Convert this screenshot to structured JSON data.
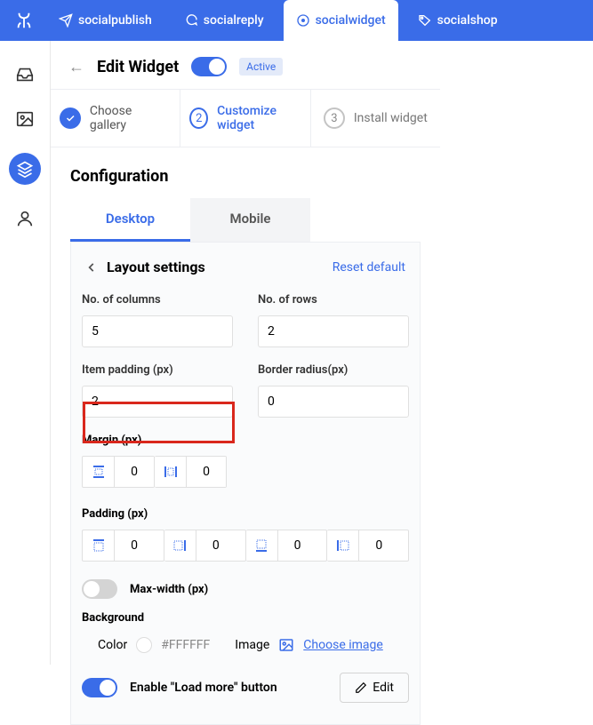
{
  "topnav": {
    "items": [
      {
        "label": "socialpublish"
      },
      {
        "label": "socialreply"
      },
      {
        "label": "socialwidget"
      },
      {
        "label": "socialshop"
      }
    ]
  },
  "page": {
    "title": "Edit Widget",
    "status_badge": "Active"
  },
  "steps": [
    {
      "num": "✓",
      "label": "Choose gallery"
    },
    {
      "num": "2",
      "label": "Customize widget"
    },
    {
      "num": "3",
      "label": "Install widget"
    }
  ],
  "configuration": {
    "title": "Configuration",
    "tabs": {
      "desktop": "Desktop",
      "mobile": "Mobile"
    }
  },
  "layout": {
    "title": "Layout settings",
    "reset": "Reset default",
    "columns": {
      "label": "No. of columns",
      "value": "5"
    },
    "rows": {
      "label": "No. of rows",
      "value": "2"
    },
    "padding": {
      "label": "Item padding (px)",
      "value": "2"
    },
    "radius": {
      "label": "Border radius(px)",
      "value": "0"
    },
    "margin": {
      "label": "Margin (px)",
      "v": "0",
      "h": "0"
    },
    "pad": {
      "label": "Padding (px)",
      "top": "0",
      "right": "0",
      "bottom": "0",
      "left": "0"
    },
    "maxwidth": {
      "label": "Max-width (px)"
    },
    "background": {
      "label": "Background",
      "color_label": "Color",
      "color_value": "#FFFFFF",
      "image_label": "Image",
      "image_link": "Choose image"
    },
    "loadmore": {
      "label": "Enable \"Load more\" button",
      "edit_label": "Edit"
    }
  }
}
